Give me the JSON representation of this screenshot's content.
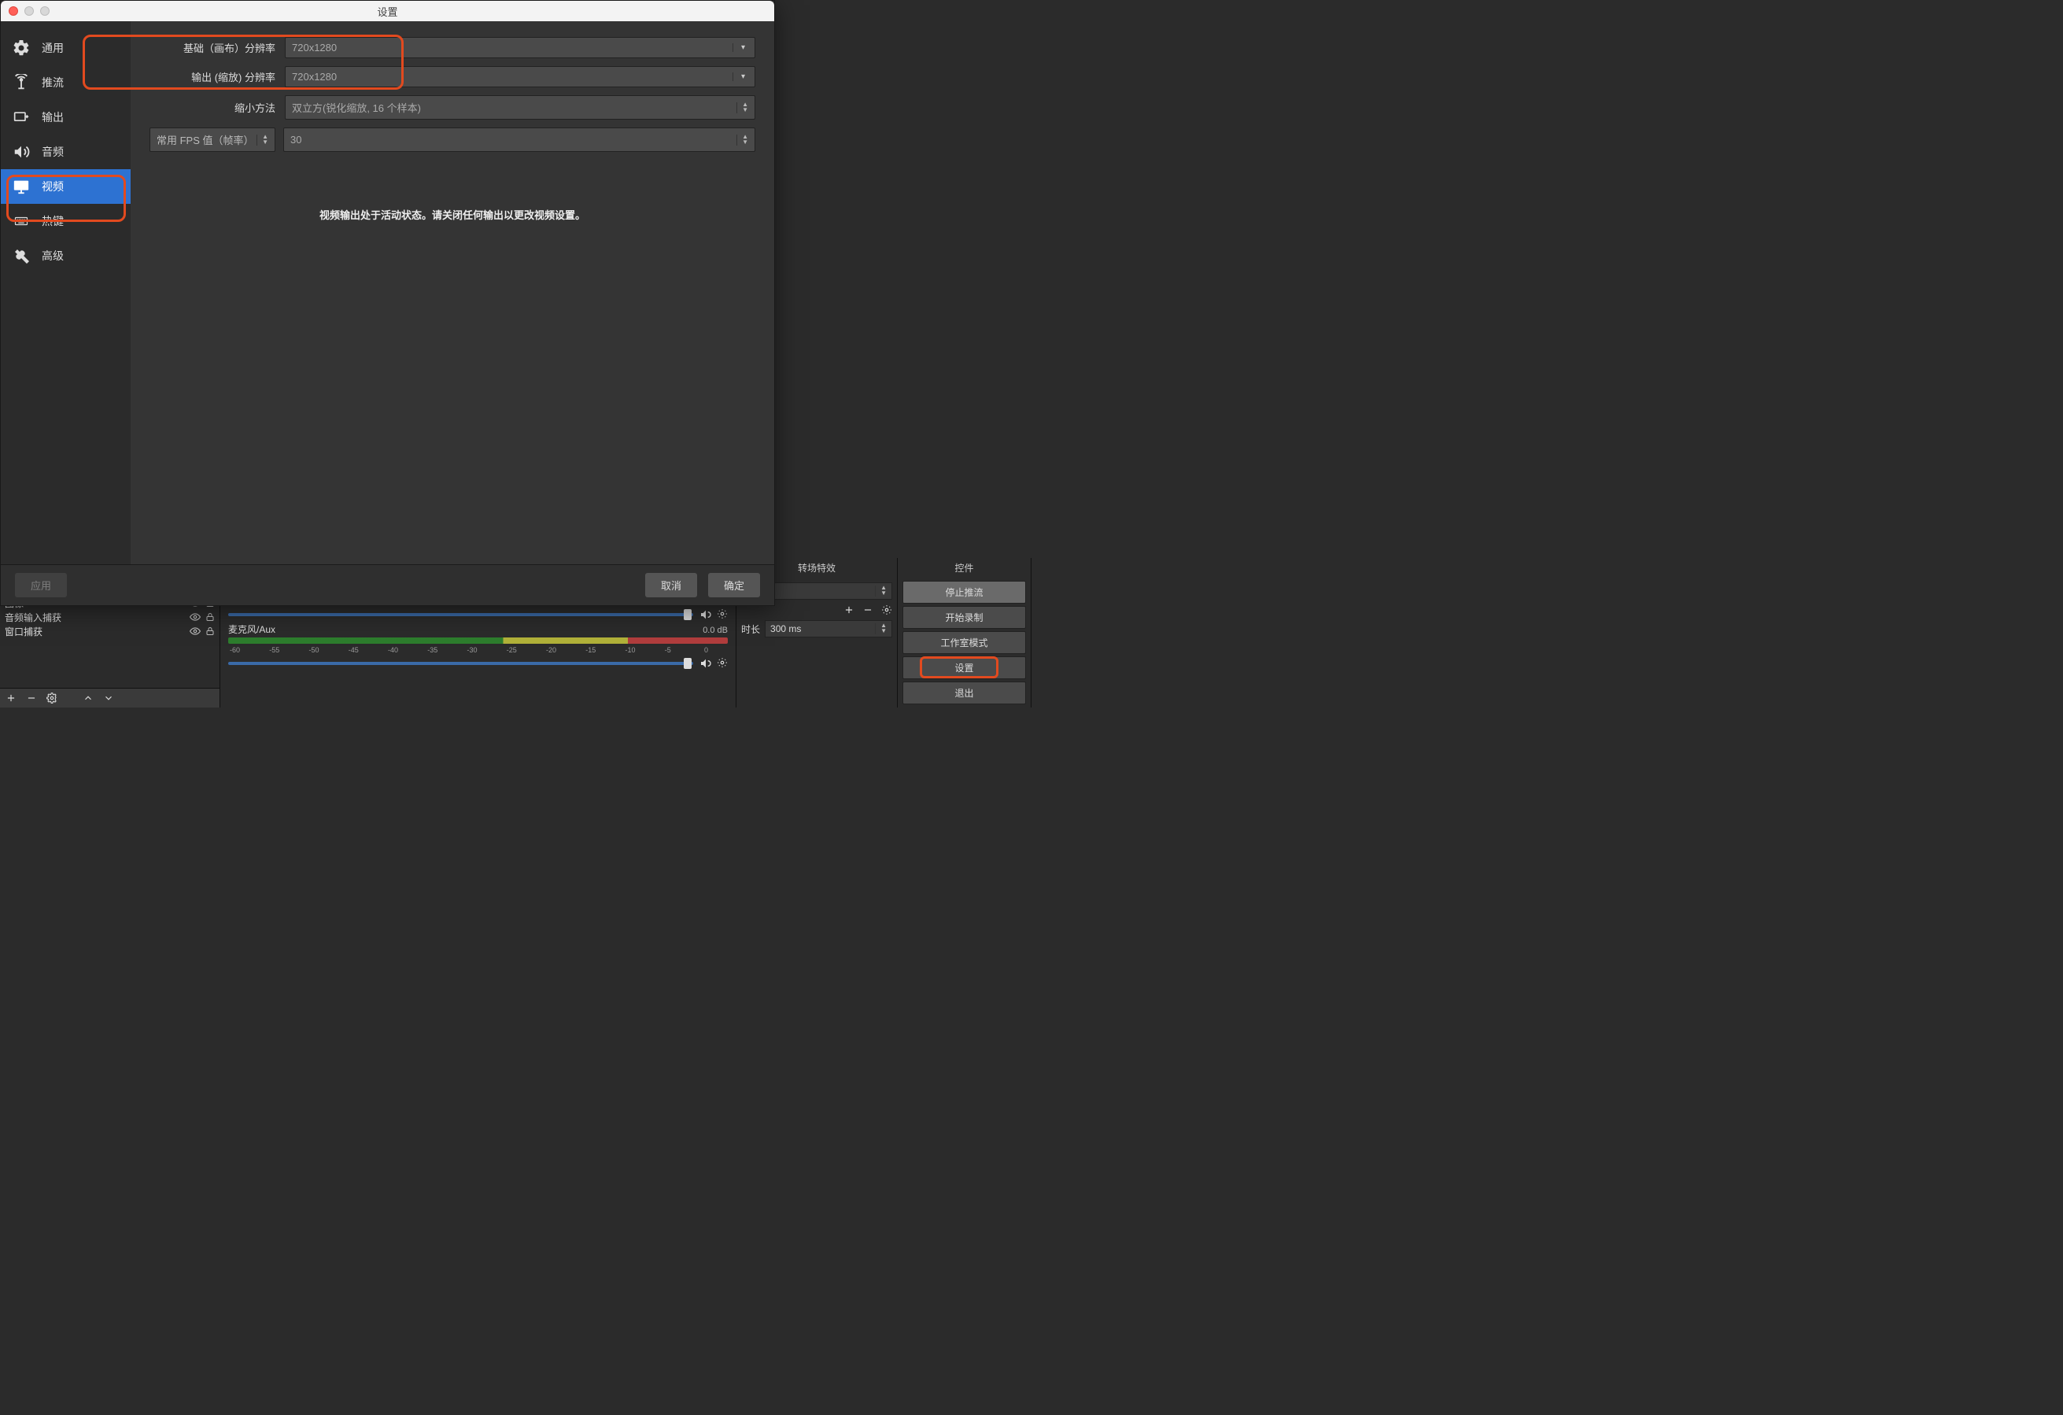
{
  "dialog": {
    "title": "设置",
    "sidebar": [
      {
        "id": "general",
        "label": "通用"
      },
      {
        "id": "stream",
        "label": "推流"
      },
      {
        "id": "output",
        "label": "输出"
      },
      {
        "id": "audio",
        "label": "音频"
      },
      {
        "id": "video",
        "label": "视频"
      },
      {
        "id": "hotkeys",
        "label": "热键"
      },
      {
        "id": "advanced",
        "label": "高级"
      }
    ],
    "video": {
      "base_label": "基础（画布）分辨率",
      "base_value": "720x1280",
      "output_label": "输出 (缩放) 分辨率",
      "output_value": "720x1280",
      "downscale_label": "缩小方法",
      "downscale_value": "双立方(锐化缩放, 16 个样本)",
      "fps_type_label": "常用 FPS 值（帧率）",
      "fps_value": "30",
      "active_msg": "视频输出处于活动状态。请关闭任何输出以更改视频设置。"
    },
    "buttons": {
      "apply": "应用",
      "cancel": "取消",
      "ok": "确定"
    }
  },
  "main": {
    "sources": {
      "items": [
        {
          "label": "图像"
        },
        {
          "label": "音频输入捕获"
        },
        {
          "label": "窗口捕获"
        }
      ]
    },
    "mixer": {
      "scale": [
        "-60",
        "-55",
        "-50",
        "-45",
        "-40",
        "-35",
        "-30",
        "-25",
        "-20",
        "-15",
        "-10",
        "-5",
        "0"
      ],
      "mic": {
        "name": "麦克风/Aux",
        "db": "0.0 dB"
      }
    },
    "transitions": {
      "title": "转场特效",
      "duration_label": "时长",
      "duration_value": "300 ms"
    },
    "controls": {
      "title": "控件",
      "stop_stream": "停止推流",
      "start_record": "开始录制",
      "studio_mode": "工作室模式",
      "settings": "设置",
      "exit": "退出"
    }
  }
}
